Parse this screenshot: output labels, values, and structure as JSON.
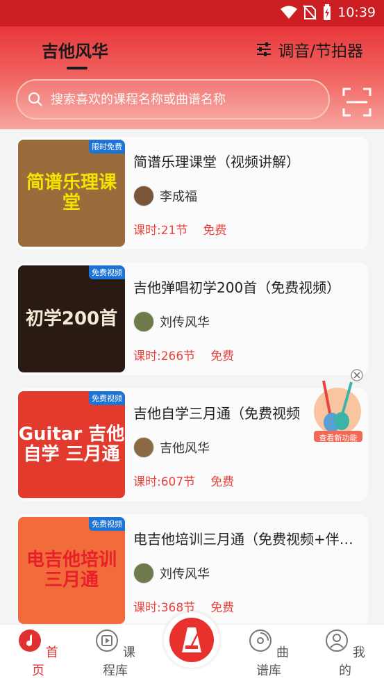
{
  "status_bar": {
    "time": "10:39"
  },
  "header": {
    "tab_title": "吉他风华",
    "tuner_label": "调音/节拍器",
    "search_placeholder": "搜索喜欢的课程名称或曲谱名称"
  },
  "courses": [
    {
      "title": "简谱乐理课堂（视频讲解）",
      "author": "李成福",
      "lessons": "课时:21节",
      "price": "免费",
      "badge": "限时免费",
      "cover_text": "简谱乐理课堂",
      "cover_bg": "#9a6b3b",
      "cover_color": "#f5e200"
    },
    {
      "title": "吉他弹唱初学200首（免费视频）",
      "author": "刘传风华",
      "lessons": "课时:266节",
      "price": "免费",
      "badge": "免费视频",
      "cover_text": "初学200首",
      "cover_bg": "#2a1a14",
      "cover_color": "#f3ead7"
    },
    {
      "title": "吉他自学三月通（免费视频",
      "author": "吉他风华",
      "lessons": "课时:607节",
      "price": "免费",
      "badge": "免费视频",
      "cover_text": "Guitar 吉他自学 三月通",
      "cover_bg": "#e23a2d",
      "cover_color": "#ffffff"
    },
    {
      "title": "电吉他培训三月通（免费视频+伴…",
      "author": "刘传风华",
      "lessons": "课时:368节",
      "price": "免费",
      "badge": "免费视频",
      "cover_text": "电吉他培训 三月通",
      "cover_bg": "#f26b3a",
      "cover_color": "#e8202a"
    }
  ],
  "float_badge": {
    "label": "查看新功能"
  },
  "bottom_nav": {
    "home": "首页",
    "courses": "课程库",
    "scores": "曲谱库",
    "mine": "我的"
  },
  "colors": {
    "accent": "#e0302f",
    "status_bar": "#cc1f24",
    "header_top": "#e8363b",
    "price": "#e8443f"
  }
}
